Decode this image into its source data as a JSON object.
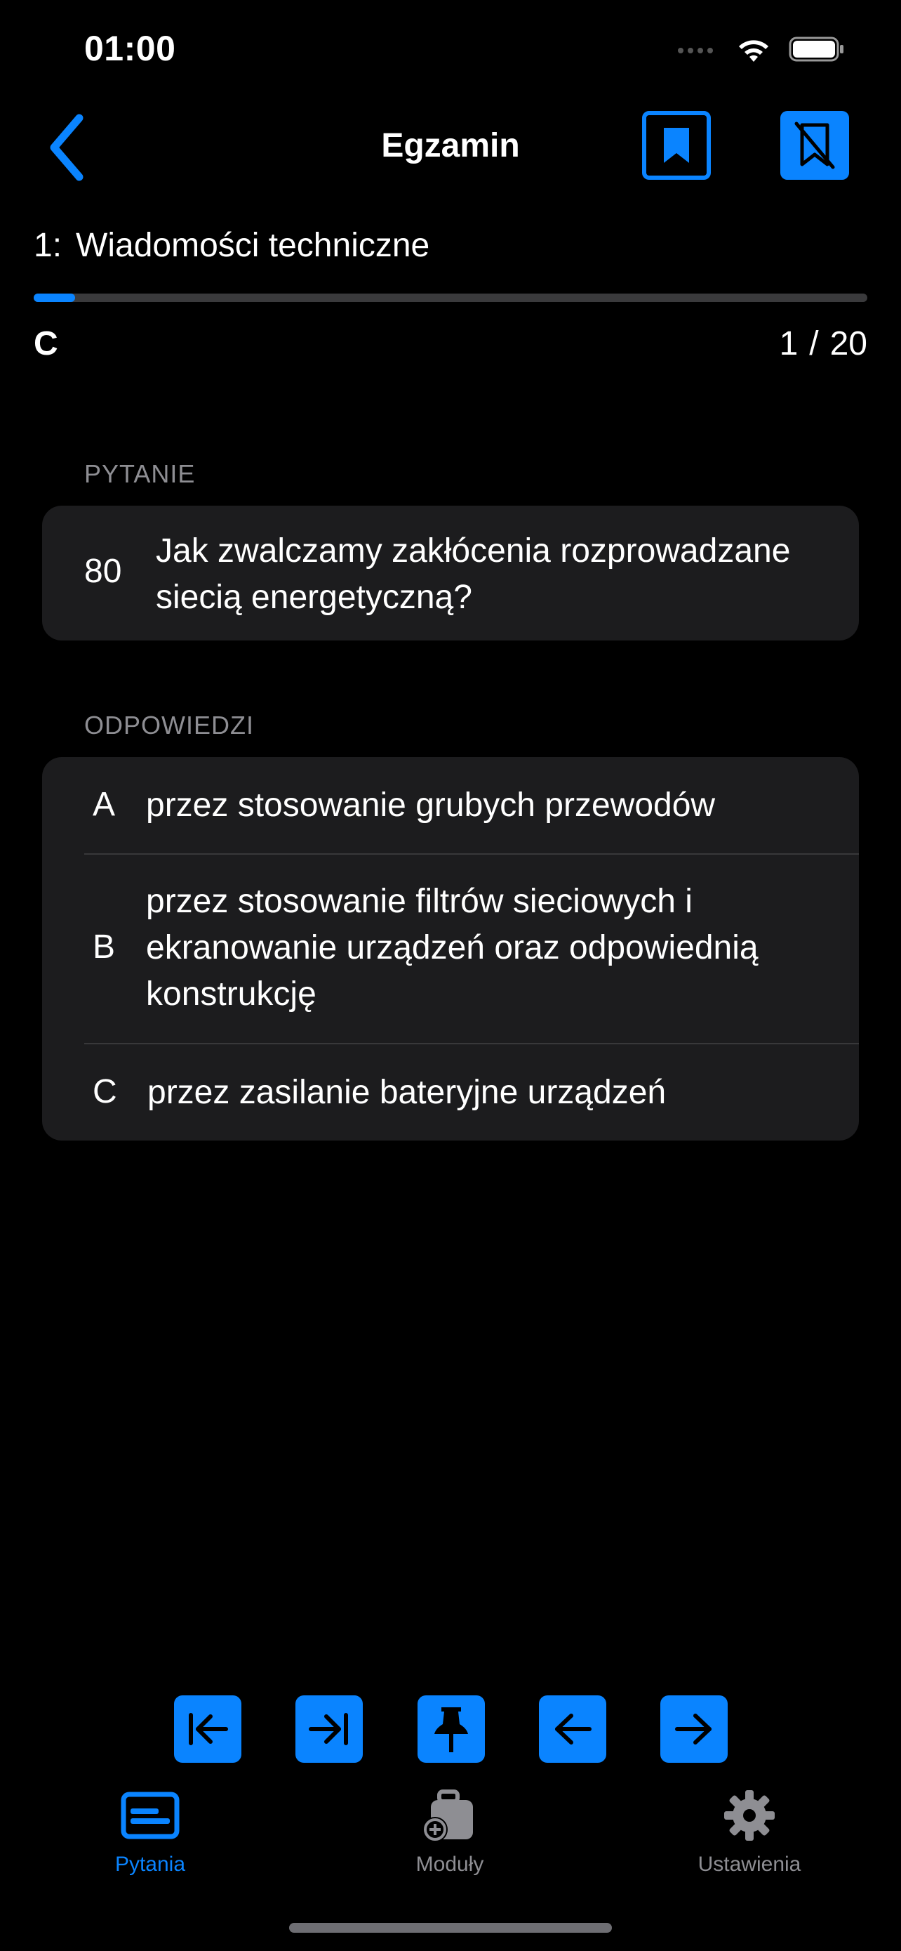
{
  "status_bar": {
    "time": "01:00"
  },
  "nav": {
    "title": "Egzamin"
  },
  "section": {
    "number": "1:",
    "title": "Wiadomości techniczne"
  },
  "progress": {
    "current": "1",
    "separator": "/",
    "total": "20",
    "fraction": 0.05
  },
  "correct_answer_letter": "C",
  "question": {
    "label": "PYTANIE",
    "number": "80",
    "text": "Jak zwalczamy zakłócenia rozprowadzane siecią energetyczną?"
  },
  "answers": {
    "label": "ODPOWIEDZI",
    "items": [
      {
        "letter": "A",
        "text": "przez stosowanie grubych przewodów"
      },
      {
        "letter": "B",
        "text": "przez stosowanie filtrów sieciowych i ekranowanie urządzeń oraz odpowiednią konstrukcję"
      },
      {
        "letter": "C",
        "text": "przez zasilanie bateryjne urządzeń"
      }
    ]
  },
  "toolbar": {
    "icons": [
      "first-question-icon",
      "last-question-icon",
      "pin-icon",
      "previous-icon",
      "next-icon"
    ]
  },
  "tabs": [
    {
      "label": "Pytania",
      "icon": "card-icon",
      "active": true
    },
    {
      "label": "Moduły",
      "icon": "add-module-icon",
      "active": false
    },
    {
      "label": "Ustawienia",
      "icon": "gear-icon",
      "active": false
    }
  ],
  "colors": {
    "accent": "#0a84ff",
    "inactive": "#8e8e93",
    "card": "#1c1c1e",
    "background": "#000000"
  }
}
